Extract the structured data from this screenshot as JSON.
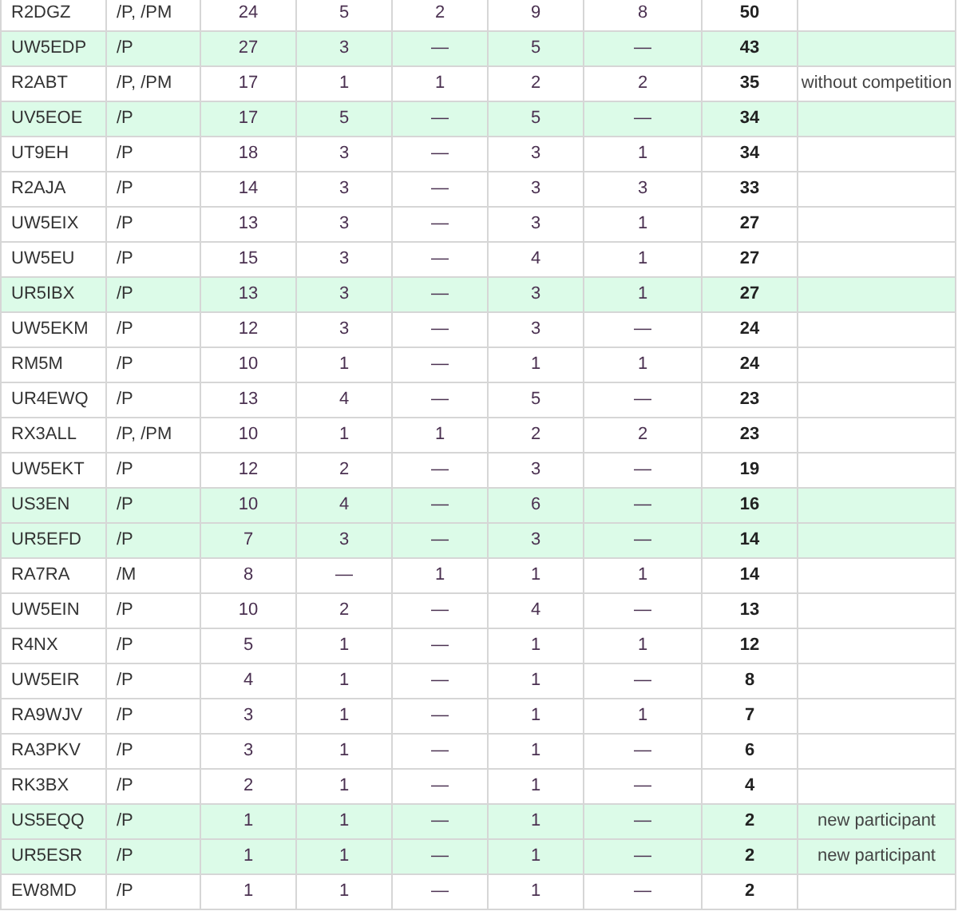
{
  "table": {
    "rows": [
      {
        "highlighted": false,
        "cells": [
          "R2DGZ",
          "/P, /PM",
          "24",
          "5",
          "2",
          "9",
          "8",
          "50"
        ]
      },
      {
        "highlighted": true,
        "cells": [
          "UW5EDP",
          "/P",
          "27",
          "3",
          "—",
          "5",
          "—",
          "43"
        ]
      },
      {
        "highlighted": false,
        "cells": [
          "R2ABT",
          "/P, /PM",
          "17",
          "1",
          "1",
          "2",
          "2",
          "35"
        ],
        "note": "without competition"
      },
      {
        "highlighted": true,
        "cells": [
          "UV5EOE",
          "/P",
          "17",
          "5",
          "—",
          "5",
          "—",
          "34"
        ]
      },
      {
        "highlighted": false,
        "cells": [
          "UT9EH",
          "/P",
          "18",
          "3",
          "—",
          "3",
          "1",
          "34"
        ]
      },
      {
        "highlighted": false,
        "cells": [
          "R2AJA",
          "/P",
          "14",
          "3",
          "—",
          "3",
          "3",
          "33"
        ]
      },
      {
        "highlighted": false,
        "cells": [
          "UW5EIX",
          "/P",
          "13",
          "3",
          "—",
          "3",
          "1",
          "27"
        ]
      },
      {
        "highlighted": false,
        "cells": [
          "UW5EU",
          "/P",
          "15",
          "3",
          "—",
          "4",
          "1",
          "27"
        ]
      },
      {
        "highlighted": true,
        "cells": [
          "UR5IBX",
          "/P",
          "13",
          "3",
          "—",
          "3",
          "1",
          "27"
        ]
      },
      {
        "highlighted": false,
        "cells": [
          "UW5EKM",
          "/P",
          "12",
          "3",
          "—",
          "3",
          "—",
          "24"
        ]
      },
      {
        "highlighted": false,
        "cells": [
          "RM5M",
          "/P",
          "10",
          "1",
          "—",
          "1",
          "1",
          "24"
        ]
      },
      {
        "highlighted": false,
        "cells": [
          "UR4EWQ",
          "/P",
          "13",
          "4",
          "—",
          "5",
          "—",
          "23"
        ]
      },
      {
        "highlighted": false,
        "cells": [
          "RX3ALL",
          "/P, /PM",
          "10",
          "1",
          "1",
          "2",
          "2",
          "23"
        ]
      },
      {
        "highlighted": false,
        "cells": [
          "UW5EKT",
          "/P",
          "12",
          "2",
          "—",
          "3",
          "—",
          "19"
        ]
      },
      {
        "highlighted": true,
        "cells": [
          "US3EN",
          "/P",
          "10",
          "4",
          "—",
          "6",
          "—",
          "16"
        ]
      },
      {
        "highlighted": true,
        "cells": [
          "UR5EFD",
          "/P",
          "7",
          "3",
          "—",
          "3",
          "—",
          "14"
        ]
      },
      {
        "highlighted": false,
        "cells": [
          "RA7RA",
          "/M",
          "8",
          "—",
          "1",
          "1",
          "1",
          "14"
        ]
      },
      {
        "highlighted": false,
        "cells": [
          "UW5EIN",
          "/P",
          "10",
          "2",
          "—",
          "4",
          "—",
          "13"
        ]
      },
      {
        "highlighted": false,
        "cells": [
          "R4NX",
          "/P",
          "5",
          "1",
          "—",
          "1",
          "1",
          "12"
        ]
      },
      {
        "highlighted": false,
        "cells": [
          "UW5EIR",
          "/P",
          "4",
          "1",
          "—",
          "1",
          "—",
          "8"
        ]
      },
      {
        "highlighted": false,
        "cells": [
          "RA9WJV",
          "/P",
          "3",
          "1",
          "—",
          "1",
          "1",
          "7"
        ]
      },
      {
        "highlighted": false,
        "cells": [
          "RA3PKV",
          "/P",
          "3",
          "1",
          "—",
          "1",
          "—",
          "6"
        ]
      },
      {
        "highlighted": false,
        "cells": [
          "RK3BX",
          "/P",
          "2",
          "1",
          "—",
          "1",
          "—",
          "4"
        ]
      },
      {
        "highlighted": true,
        "cells": [
          "US5EQQ",
          "/P",
          "1",
          "1",
          "—",
          "1",
          "—",
          "2"
        ],
        "note": "new participant"
      },
      {
        "highlighted": true,
        "cells": [
          "UR5ESR",
          "/P",
          "1",
          "1",
          "—",
          "1",
          "—",
          "2"
        ],
        "note": "new participant"
      },
      {
        "highlighted": false,
        "cells": [
          "EW8MD",
          "/P",
          "1",
          "1",
          "—",
          "1",
          "—",
          "2"
        ]
      }
    ]
  }
}
